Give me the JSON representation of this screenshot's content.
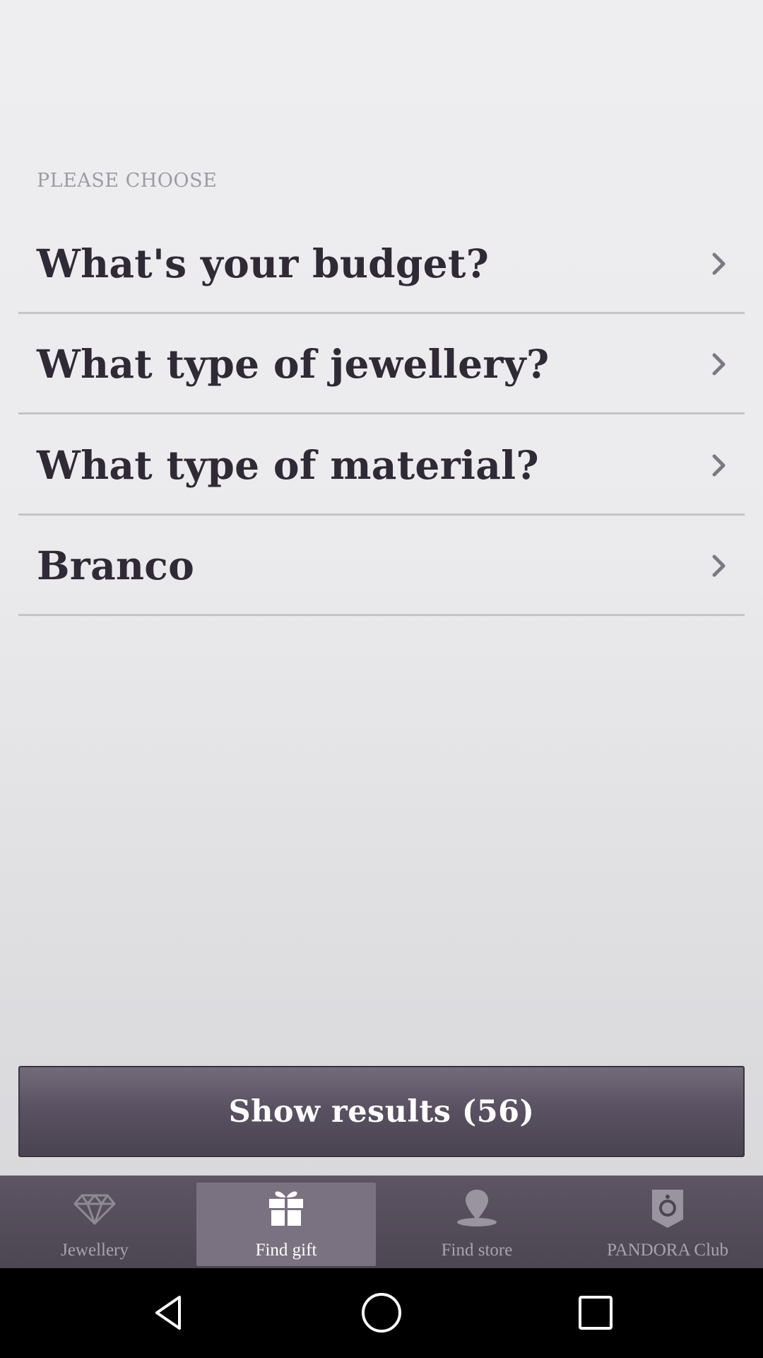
{
  "header": {
    "section_label": "PLEASE CHOOSE"
  },
  "options": [
    {
      "label": "What's your budget?",
      "icon": "chevron-right-icon"
    },
    {
      "label": "What type of jewellery?",
      "icon": "chevron-right-icon"
    },
    {
      "label": "What type of material?",
      "icon": "chevron-right-icon"
    },
    {
      "label": "Branco",
      "icon": "chevron-right-icon"
    }
  ],
  "results_button": {
    "label": "Show results (56)"
  },
  "tabs": [
    {
      "label": "Jewellery",
      "icon": "diamond-icon",
      "active": false
    },
    {
      "label": "Find gift",
      "icon": "gift-icon",
      "active": true
    },
    {
      "label": "Find store",
      "icon": "location-pin-icon",
      "active": false
    },
    {
      "label": "PANDORA Club",
      "icon": "pandora-club-icon",
      "active": false
    }
  ],
  "system_nav": {
    "back": "back-icon",
    "home": "home-icon",
    "recent": "recent-apps-icon"
  },
  "colors": {
    "text_dark": "#2f2a35",
    "label_muted": "#9e9ba4",
    "button_bg": "#5a5262",
    "tabbar_bg": "#544d5a",
    "tab_active_bg": "#7a7280"
  }
}
